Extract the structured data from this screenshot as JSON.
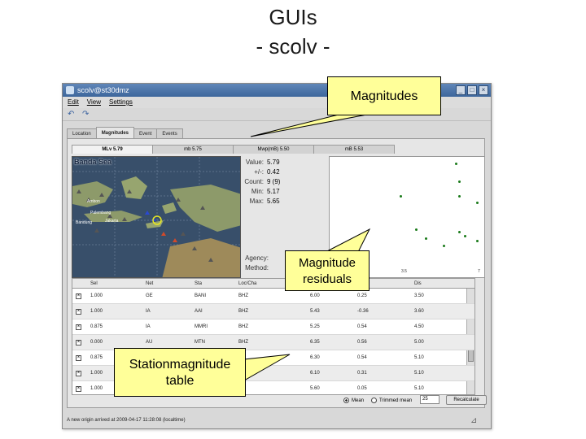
{
  "slide": {
    "title_line1": "GUIs",
    "title_line2": "- scolv -"
  },
  "window": {
    "title": "scolv@st30dmz",
    "menu": [
      "Edit",
      "View",
      "Settings"
    ],
    "main_tabs": [
      "Location",
      "Magnitudes",
      "Event",
      "Events"
    ],
    "magnitude_tabs": [
      "MLv 5.79",
      "mb 5.75",
      "Mwp(mB) 5.50",
      "mB 5.53"
    ]
  },
  "map": {
    "title": "Banda Sea",
    "labels": [
      "Ambon",
      "Palembang",
      "Bandung",
      "Jakarta"
    ]
  },
  "info": [
    {
      "key": "Value:",
      "value": "5.79"
    },
    {
      "key": "+/-:",
      "value": "0.42"
    },
    {
      "key": "Count:",
      "value": "9 (9)"
    },
    {
      "key": "Min:",
      "value": "5.17"
    },
    {
      "key": "Max:",
      "value": "5.65"
    }
  ],
  "info_lower": [
    {
      "key": "Agency:",
      "value": ""
    },
    {
      "key": "Method:",
      "value": ""
    }
  ],
  "plot": {
    "tick_labels": [
      "3.5",
      "7"
    ],
    "points": [
      [
        0.46,
        0.32
      ],
      [
        0.82,
        0.05
      ],
      [
        0.84,
        0.2
      ],
      [
        0.84,
        0.32
      ],
      [
        0.96,
        0.38
      ],
      [
        0.56,
        0.6
      ],
      [
        0.62,
        0.68
      ],
      [
        0.84,
        0.62
      ],
      [
        0.88,
        0.66
      ],
      [
        0.74,
        0.74
      ],
      [
        0.96,
        0.7
      ]
    ]
  },
  "table": {
    "columns": [
      "Sel",
      "Net",
      "Sta",
      "Loc/Cha",
      "",
      "",
      "Dis"
    ],
    "rows": [
      {
        "sel": "1.000",
        "net": "GE",
        "sta": "BANI",
        "cha": "BHZ",
        "mag": "6.00",
        "res": "0.25",
        "dis": "3.50"
      },
      {
        "sel": "1.000",
        "net": "IA",
        "sta": "AAI",
        "cha": "BHZ",
        "mag": "5.43",
        "res": "-0.36",
        "dis": "3.60"
      },
      {
        "sel": "0.875",
        "net": "IA",
        "sta": "MMRI",
        "cha": "BHZ",
        "mag": "5.25",
        "res": "0.54",
        "dis": "4.50"
      },
      {
        "sel": "0.000",
        "net": "AU",
        "sta": "MTN",
        "cha": "BHZ",
        "mag": "6.35",
        "res": "0.56",
        "dis": "5.00"
      },
      {
        "sel": "0.875",
        "net": "GE",
        "sta": "",
        "cha": "",
        "mag": "6.30",
        "res": "0.54",
        "dis": "5.10"
      },
      {
        "sel": "1.000",
        "net": "",
        "sta": "",
        "cha": "HZ",
        "mag": "6.10",
        "res": "0.31",
        "dis": "5.10"
      },
      {
        "sel": "1.000",
        "net": "",
        "sta": "",
        "cha": "HZ",
        "mag": "5.60",
        "res": "0.05",
        "dis": "5.10"
      }
    ]
  },
  "controls": {
    "radio_mean": "Mean",
    "radio_trimmed": "Trimmed mean",
    "trim_value": "25",
    "recalc": "Recalculate"
  },
  "status": "A new origin arrived at 2009-04-17 11:28:08 (localtime)",
  "callouts": {
    "magnitudes": "Magnitudes",
    "residuals_line1": "Magnitude",
    "residuals_line2": "residuals",
    "station_line1": "Stationmagnitude",
    "station_line2": "table"
  },
  "colors": {
    "callout": "#ffff99",
    "map_water": "#384f6a",
    "plot_point": "#1a7a1a"
  }
}
